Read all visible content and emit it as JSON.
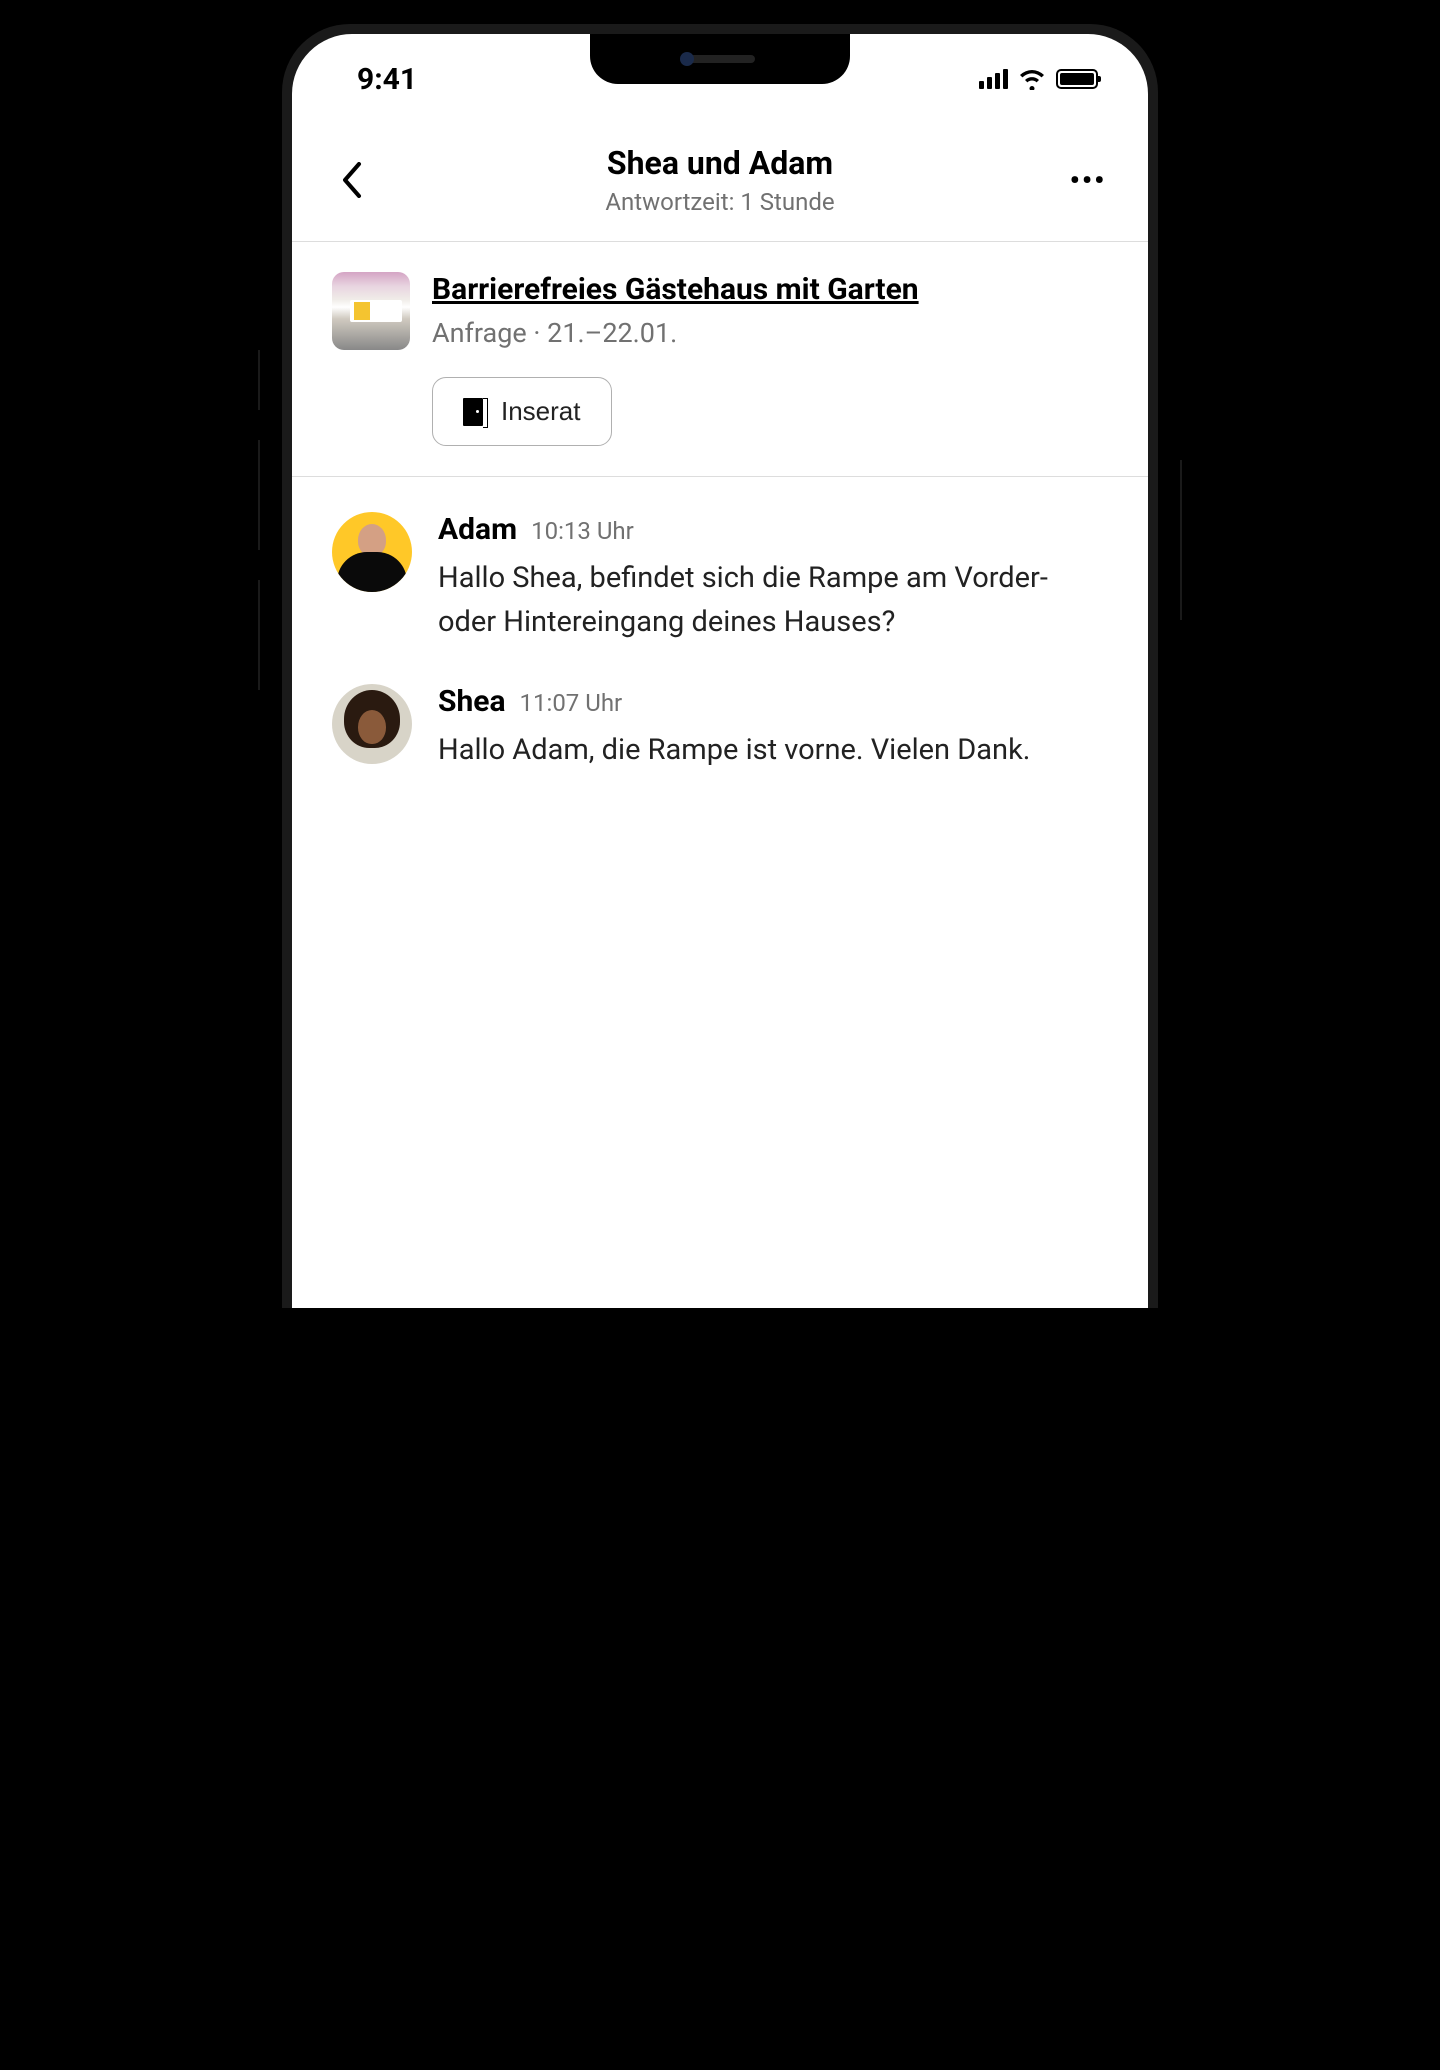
{
  "status": {
    "time": "9:41"
  },
  "header": {
    "title": "Shea und Adam",
    "subtitle": "Antwortzeit: 1 Stunde"
  },
  "listing": {
    "title": "Barrierefreies Gästehaus mit Garten",
    "meta": "Anfrage ·  21.–22.01.",
    "button_label": "Inserat"
  },
  "messages": [
    {
      "name": "Adam",
      "time": "10:13 Uhr",
      "text": "Hallo Shea, befindet sich die Rampe am Vorder- oder Hintereingang deines Hauses?",
      "avatar": "adam"
    },
    {
      "name": "Shea",
      "time": "11:07 Uhr",
      "text": "Hallo Adam, die Rampe ist vorne. Vielen Dank.",
      "avatar": "shea"
    }
  ]
}
